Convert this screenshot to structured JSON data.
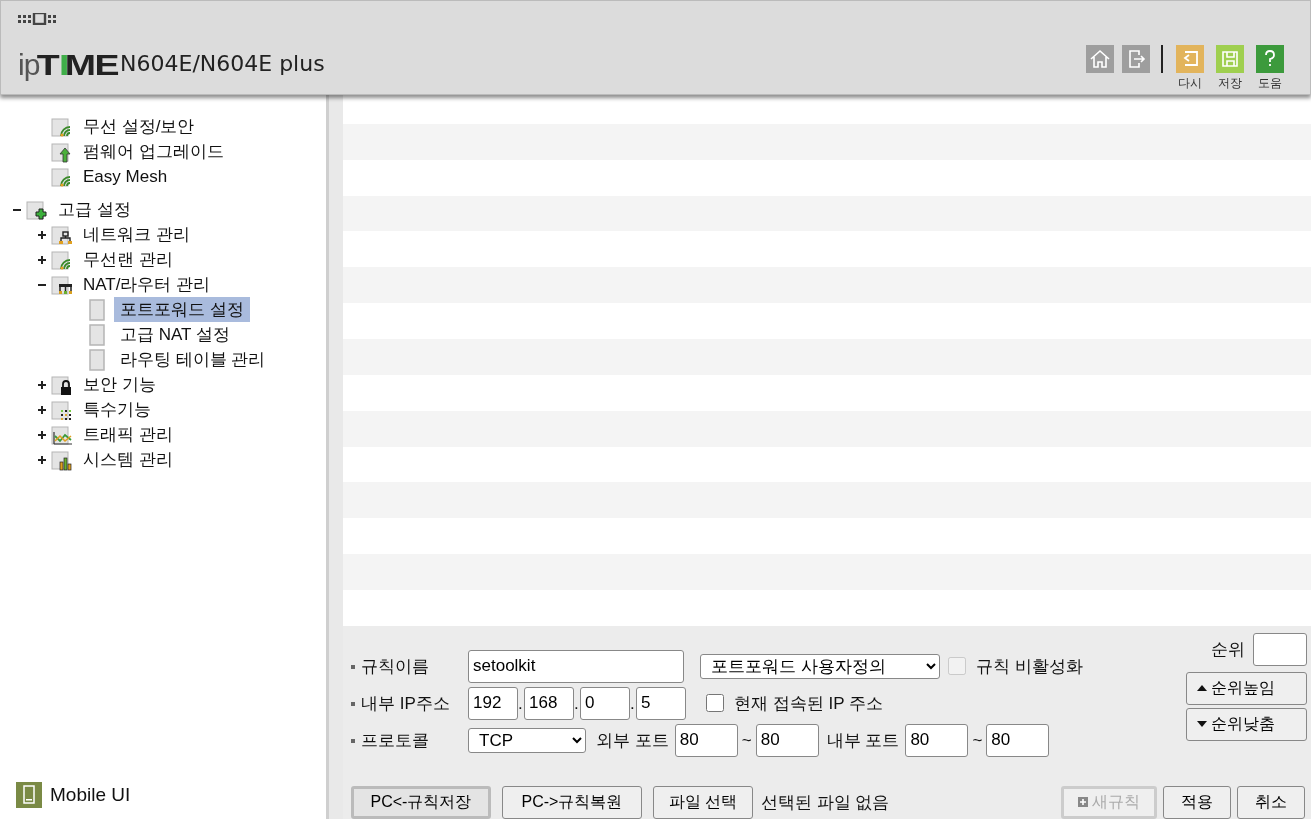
{
  "header": {
    "logo": [
      {
        "text": "ip"
      },
      {
        "text": "T"
      },
      {
        "text": "I",
        "color": "#3fae49"
      },
      {
        "text": "ME"
      }
    ],
    "model": "N604E/N604E plus",
    "tools": [
      {
        "kind": "home"
      },
      {
        "kind": "logout"
      }
    ],
    "actions": [
      {
        "kind": "reload",
        "label": "다시",
        "color": "#e2b45c"
      },
      {
        "kind": "save",
        "label": "저장",
        "color": "#9fcf4f"
      },
      {
        "kind": "help",
        "label": "도움",
        "color": "#3c9a3c"
      }
    ]
  },
  "tree": [
    {
      "children": [
        {
          "label": "무선 설정/보안",
          "kind": "wifi"
        },
        {
          "label": "펌웨어 업그레이드",
          "kind": "upgrade"
        },
        {
          "label": "Easy Mesh",
          "kind": "wifi"
        }
      ]
    },
    {
      "label": "고급 설정",
      "kind": "advanced",
      "expanded": true,
      "children": [
        {
          "label": "네트워크 관리",
          "kind": "network",
          "expanded": false
        },
        {
          "label": "무선랜 관리",
          "kind": "wifi",
          "expanded": false
        },
        {
          "label": "NAT/라우터 관리",
          "kind": "router",
          "expanded": true,
          "children": [
            {
              "label": "포트포워드 설정",
              "kind": "page",
              "selected": true
            },
            {
              "label": "고급 NAT 설정",
              "kind": "page",
              "selected": false
            },
            {
              "label": "라우팅 테이블 관리",
              "kind": "page",
              "selected": false
            }
          ]
        },
        {
          "label": "보안 기능",
          "kind": "lock",
          "expanded": false
        },
        {
          "label": "특수기능",
          "kind": "dots",
          "expanded": false
        },
        {
          "label": "트래픽 관리",
          "kind": "traffic",
          "expanded": false
        },
        {
          "label": "시스템 관리",
          "kind": "chart",
          "expanded": false
        }
      ]
    }
  ],
  "mobile_link": "Mobile UI",
  "form": {
    "rule_name": {
      "label": "규칙이름",
      "value": "setoolkit"
    },
    "rule_type": {
      "value": "포트포워드 사용자정의"
    },
    "disable_rule": {
      "label": "규칙 비활성화",
      "checked": false,
      "disabled": true
    },
    "internal_ip": {
      "label": "내부 IP주소",
      "octets": [
        "192",
        "168",
        "0",
        "5"
      ],
      "separators": [
        ".",
        ".",
        "."
      ]
    },
    "current_ip": {
      "label": "현재 접속된 IP 주소",
      "checked": false,
      "disabled": false
    },
    "protocol": {
      "label": "프로토콜",
      "value": "TCP"
    },
    "external_port": {
      "label": "외부 포트",
      "from": "80",
      "separator": "~",
      "to": "80"
    },
    "internal_port": {
      "label": "내부 포트",
      "from": "80",
      "separator": "~",
      "to": "80"
    },
    "priority": {
      "label": "순위"
    },
    "priority_buttons": [
      {
        "kind": "up",
        "label": "순위높임"
      },
      {
        "kind": "down",
        "label": "순위낮춤"
      }
    ],
    "file_buttons": [
      {
        "label": "PC<-규칙저장",
        "focused": true
      },
      {
        "label": "PC->규칙복원",
        "focused": false
      }
    ],
    "file_chooser": {
      "button": "파일 선택",
      "status": "선택된 파일 없음"
    },
    "new_rule": {
      "label": "새규칙",
      "disabled": true
    },
    "actions": [
      "적용",
      "취소"
    ]
  }
}
